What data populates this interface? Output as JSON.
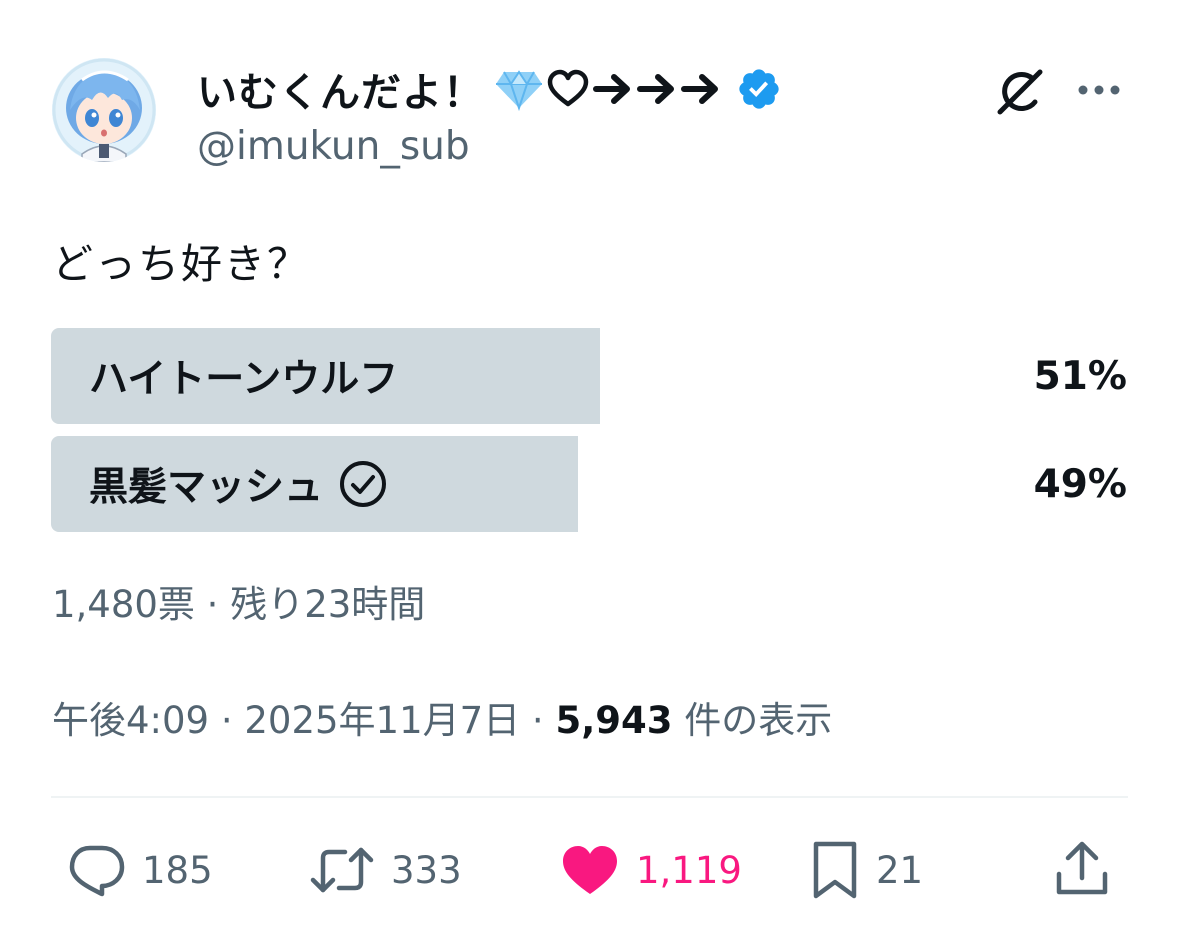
{
  "user": {
    "display_name": "いむくんだよ！",
    "name_decorations": [
      "diamond-icon",
      "heart-outline-icon",
      "arrow-right-icon",
      "arrow-right-icon",
      "arrow-right-icon"
    ],
    "verified": true,
    "handle": "@imukun_sub"
  },
  "tweet": {
    "text": "どっち好き？"
  },
  "poll": {
    "options": [
      {
        "label": "ハイトーンウルフ",
        "percent_text": "51%",
        "percent": 51,
        "voted": false
      },
      {
        "label": "黒髪マッシュ",
        "percent_text": "49%",
        "percent": 49,
        "voted": true
      }
    ],
    "votes_and_time": "1,480票 · 残り23時間"
  },
  "meta": {
    "time_date": "午後4:09 · 2025年11月7日 · ",
    "views_count": "5,943",
    "views_label": " 件の表示"
  },
  "actions": {
    "reply_count": "185",
    "retweet_count": "333",
    "like_count": "1,119",
    "bookmark_count": "21"
  },
  "colors": {
    "text": "#0f1419",
    "secondary": "#536471",
    "verified": "#1d9bf0",
    "like": "#f91880",
    "poll_bar": "#cfd9de"
  }
}
